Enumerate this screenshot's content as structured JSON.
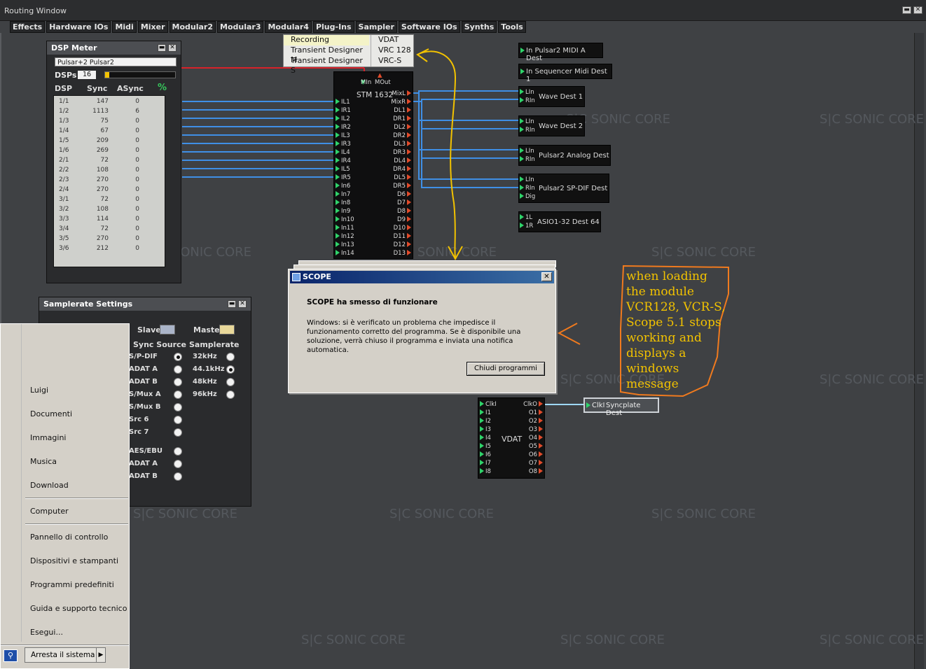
{
  "window": {
    "title": "Routing Window",
    "min_glyph": "▬",
    "close_glyph": "✕"
  },
  "menu": [
    "Effects",
    "Hardware IOs",
    "Midi",
    "Mixer",
    "Modular2",
    "Modular3",
    "Modular4",
    "Plug-Ins",
    "Sampler",
    "Software IOs",
    "Synths",
    "Tools"
  ],
  "watermark": "S|C SONIC CORE",
  "plugin_list": {
    "left": [
      "Recording",
      "Transient Designer M",
      "Transient Designer S"
    ],
    "right": [
      "VDAT",
      "VRC 128",
      "VRC-S"
    ]
  },
  "dsp_meter": {
    "title": "DSP Meter",
    "source": "Pulsar+2 Pulsar2",
    "dsps_label": "DSPs",
    "dsps_count": "16",
    "headers": [
      "DSP",
      "Sync",
      "ASync",
      "%"
    ],
    "rows": [
      [
        "1/1",
        "147",
        "0"
      ],
      [
        "1/2",
        "1113",
        "6"
      ],
      [
        "1/3",
        "75",
        "0"
      ],
      [
        "1/4",
        "67",
        "0"
      ],
      [
        "1/5",
        "209",
        "0"
      ],
      [
        "1/6",
        "269",
        "0"
      ],
      [
        "2/1",
        "72",
        "0"
      ],
      [
        "2/2",
        "108",
        "0"
      ],
      [
        "2/3",
        "270",
        "0"
      ],
      [
        "2/4",
        "270",
        "0"
      ],
      [
        "3/1",
        "72",
        "0"
      ],
      [
        "3/2",
        "108",
        "0"
      ],
      [
        "3/3",
        "114",
        "0"
      ],
      [
        "3/4",
        "72",
        "0"
      ],
      [
        "3/5",
        "270",
        "0"
      ],
      [
        "3/6",
        "212",
        "0"
      ]
    ]
  },
  "samplerate": {
    "title": "Samplerate Settings",
    "slave": "Slave",
    "master": "Master",
    "sync_source_label": "Sync Source",
    "samplerate_label": "Samplerate",
    "sources": [
      "S/P-DIF",
      "ADAT A",
      "ADAT B",
      "S/Mux A",
      "S/Mux B",
      "Src 6",
      "Src 7",
      "AES/EBU",
      "ADAT A",
      "ADAT B"
    ],
    "rates": [
      "32kHz",
      "44.1kHz",
      "48kHz",
      "96kHz"
    ]
  },
  "stm": {
    "name": "STM 1632",
    "min": "MIn",
    "mout": "MOut",
    "inputs": [
      "IL1",
      "IR1",
      "IL2",
      "IR2",
      "IL3",
      "IR3",
      "IL4",
      "IR4",
      "IL5",
      "IR5",
      "In6",
      "In7",
      "In8",
      "In9",
      "In10",
      "In11",
      "In12",
      "In13",
      "In14"
    ],
    "outputs": [
      "MixL",
      "MixR",
      "DL1",
      "DR1",
      "DL2",
      "DR2",
      "DL3",
      "DR3",
      "DL4",
      "DR4",
      "DL5",
      "DR5",
      "D6",
      "D7",
      "D8",
      "D9",
      "D10",
      "D11",
      "D12",
      "D13"
    ]
  },
  "dests": [
    {
      "name": "In Pulsar2 MIDI A Dest",
      "pins": []
    },
    {
      "name": "In Sequencer Midi Dest 1",
      "pins": []
    },
    {
      "name": "Wave Dest 1",
      "pins": [
        "LIn",
        "RIn"
      ]
    },
    {
      "name": "Wave Dest 2",
      "pins": [
        "LIn",
        "RIn"
      ]
    },
    {
      "name": "Pulsar2 Analog Dest",
      "pins": [
        "LIn",
        "RIn"
      ]
    },
    {
      "name": "Pulsar2 SP-DIF Dest",
      "pins": [
        "LIn",
        "RIn",
        "Dig"
      ]
    },
    {
      "name": "ASIO1-32 Dest 64",
      "pins": [
        "1L",
        "1R"
      ]
    }
  ],
  "vdat": {
    "name": "VDAT",
    "inputs": [
      "ClkI",
      "I1",
      "I2",
      "I3",
      "I4",
      "I5",
      "I6",
      "I7",
      "I8"
    ],
    "outputs": [
      "ClkO",
      "O1",
      "O2",
      "O3",
      "O4",
      "O5",
      "O6",
      "O7",
      "O8"
    ]
  },
  "syncplate": {
    "pin": "ClkI",
    "name": "Syncplate Dest"
  },
  "dialog": {
    "title": "SCOPE",
    "heading": "SCOPE ha smesso di funzionare",
    "body": "Windows: si è verificato un problema che impedisce il funzionamento corretto del programma. Se è disponibile una soluzione, verrà chiuso il programma e inviata una notifica automatica.",
    "button": "Chiudi programmi"
  },
  "start_menu": {
    "items_top": [
      "Luigi",
      "Documenti",
      "Immagini",
      "Musica",
      "Download"
    ],
    "items_mid": [
      "Computer"
    ],
    "items_bottom": [
      "Pannello di controllo",
      "Dispositivi e stampanti",
      "Programmi predefiniti",
      "Guida e supporto tecnico",
      "Esegui..."
    ],
    "shutdown": "Arresta il sistema"
  },
  "annotation": "when loading the module VCR128, VCR-S, Scope 5.1 stops working and displays a windows message",
  "colors": {
    "annotation": "#f2c200",
    "annotation_border": "#f07a1e",
    "wire": "#3f8fe6",
    "wire_red": "#d8222a",
    "arrow": "#f2c200"
  }
}
